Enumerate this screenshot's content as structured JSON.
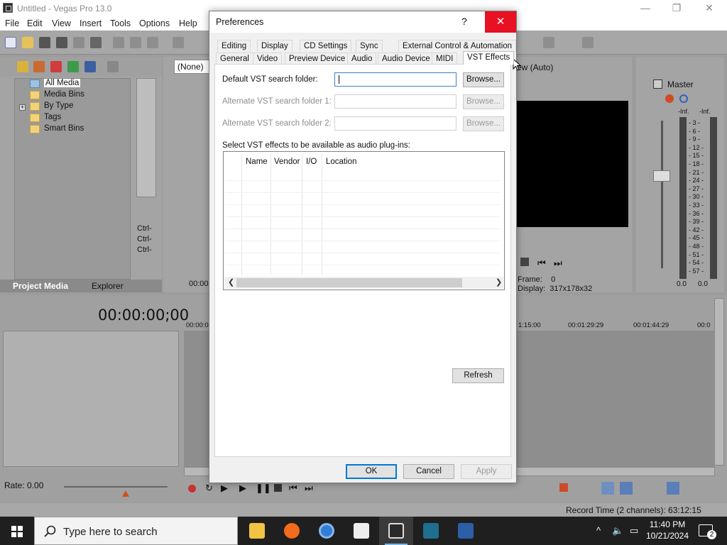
{
  "window": {
    "title": "Untitled - Vegas Pro 13.0",
    "minimize": "—",
    "restore": "❐",
    "close": "✕"
  },
  "menu": [
    "File",
    "Edit",
    "View",
    "Insert",
    "Tools",
    "Options",
    "Help"
  ],
  "project_media": {
    "tree": [
      "All Media",
      "Media Bins",
      "By Type",
      "Tags",
      "Smart Bins"
    ],
    "tabs": [
      "Project Media",
      "Explorer"
    ]
  },
  "trimmer": {
    "dropdown": "(None)",
    "shortcuts": [
      "Ctrl-",
      "Ctrl-",
      "Ctrl-"
    ],
    "time": "00:00"
  },
  "preview": {
    "view_label": "ew (Auto)",
    "frame_label": "Frame:",
    "frame_value": "0",
    "display_label": "Display:",
    "display_value": "317x178x32"
  },
  "master": {
    "label": "Master",
    "inf_left": "-Inf.",
    "inf_right": "-Inf.",
    "scale": [
      "3",
      "6",
      "9",
      "12",
      "15",
      "18",
      "21",
      "24",
      "27",
      "30",
      "33",
      "36",
      "39",
      "42",
      "45",
      "48",
      "51",
      "54",
      "57"
    ],
    "db_left": "0.0",
    "db_right": "0.0"
  },
  "timeline": {
    "timecode": "00:00:00;00",
    "ruler": [
      "00:00:0",
      "1:15:00",
      "00:01:29:29",
      "00:01:44:29",
      "00:0"
    ],
    "rate": "Rate: 0.00"
  },
  "status": {
    "record_time": "Record Time (2 channels): 63:12:15"
  },
  "dialog": {
    "title": "Preferences",
    "help": "?",
    "close": "✕",
    "tabs_row1": [
      "Editing",
      "Display",
      "CD Settings",
      "Sync",
      "External Control & Automation"
    ],
    "tabs_row2": [
      "General",
      "Video",
      "Preview Device",
      "Audio",
      "Audio Device",
      "MIDI",
      "VST Effects"
    ],
    "default_folder_label": "Default VST search folder:",
    "default_folder_value": "",
    "alt1_label": "Alternate VST search folder 1:",
    "alt2_label": "Alternate VST search folder 2:",
    "browse": "Browse...",
    "select_label": "Select VST effects to be available as audio plug-ins:",
    "columns": [
      "Name",
      "Vendor",
      "I/O",
      "Location"
    ],
    "refresh": "Refresh",
    "ok": "OK",
    "cancel": "Cancel",
    "apply": "Apply"
  },
  "taskbar": {
    "search_placeholder": "Type here to search",
    "time": "11:40 PM",
    "date": "10/21/2024",
    "notifications": "2"
  }
}
